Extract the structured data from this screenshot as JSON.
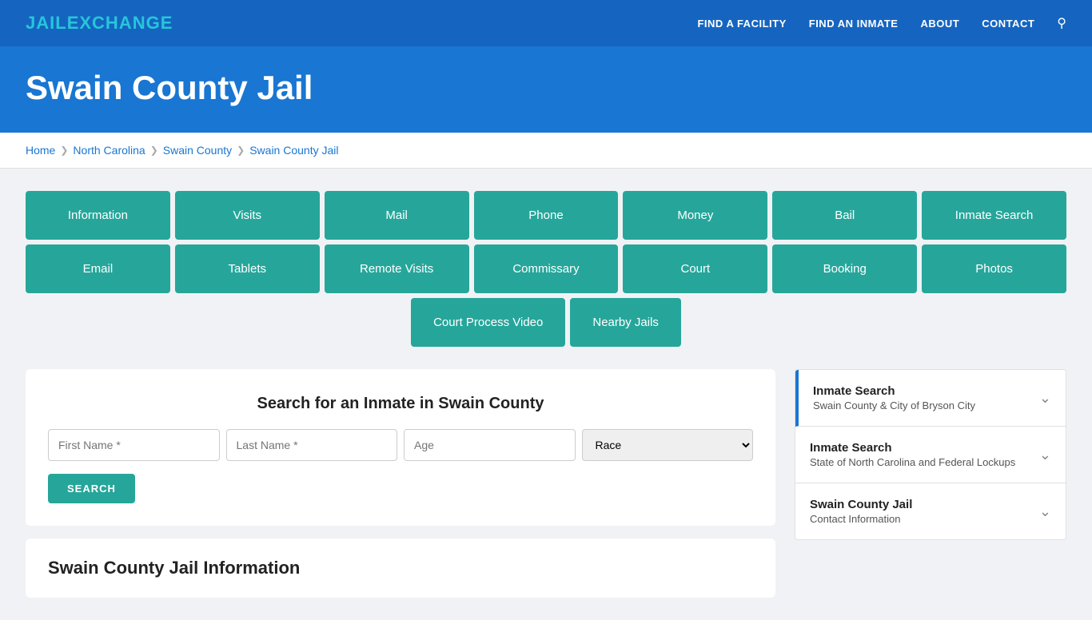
{
  "nav": {
    "logo_jail": "JAIL",
    "logo_exchange": "EXCHANGE",
    "links": [
      {
        "label": "FIND A FACILITY",
        "name": "find-facility-link"
      },
      {
        "label": "FIND AN INMATE",
        "name": "find-inmate-link"
      },
      {
        "label": "ABOUT",
        "name": "about-link"
      },
      {
        "label": "CONTACT",
        "name": "contact-link"
      }
    ]
  },
  "hero": {
    "title": "Swain County Jail"
  },
  "breadcrumb": {
    "home": "Home",
    "state": "North Carolina",
    "county": "Swain County",
    "facility": "Swain County Jail"
  },
  "buttons_row1": [
    "Information",
    "Visits",
    "Mail",
    "Phone",
    "Money",
    "Bail",
    "Inmate Search"
  ],
  "buttons_row2": [
    "Email",
    "Tablets",
    "Remote Visits",
    "Commissary",
    "Court",
    "Booking",
    "Photos"
  ],
  "buttons_row3": [
    "Court Process Video",
    "Nearby Jails"
  ],
  "search": {
    "title": "Search for an Inmate in Swain County",
    "first_name_placeholder": "First Name *",
    "last_name_placeholder": "Last Name *",
    "age_placeholder": "Age",
    "race_placeholder": "Race",
    "search_button": "SEARCH"
  },
  "sidebar": {
    "items": [
      {
        "title": "Inmate Search",
        "sub": "Swain County & City of Bryson City",
        "active": true
      },
      {
        "title": "Inmate Search",
        "sub": "State of North Carolina and Federal Lockups",
        "active": false
      },
      {
        "title": "Swain County Jail",
        "sub": "Contact Information",
        "active": false
      }
    ]
  },
  "info_section": {
    "title": "Swain County Jail Information"
  }
}
